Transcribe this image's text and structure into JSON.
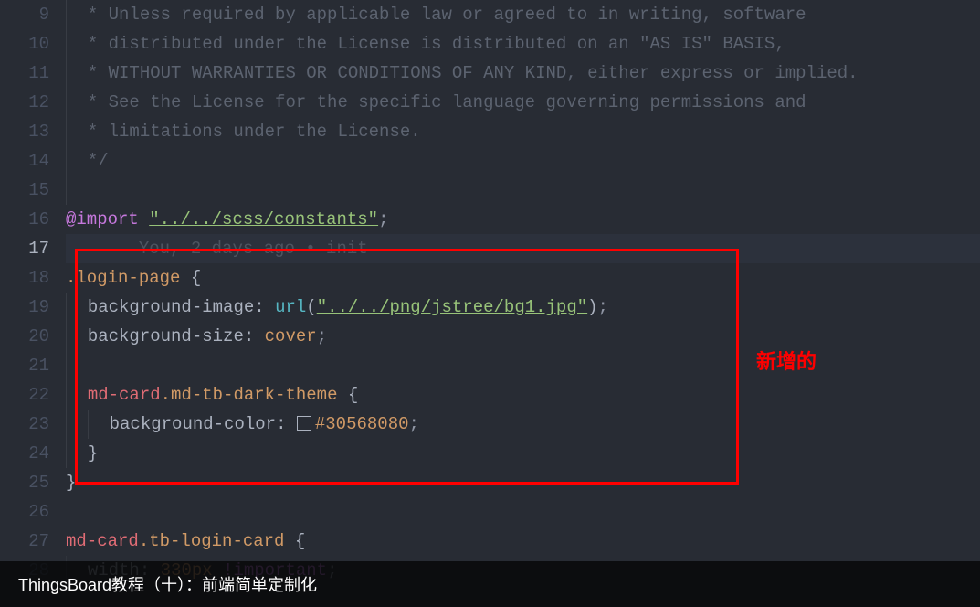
{
  "lines": {
    "start": 9,
    "end": 28
  },
  "comment": {
    "l9": " * Unless required by applicable law or agreed to in writing, software",
    "l10": " * distributed under the License is distributed on an \"AS IS\" BASIS,",
    "l11": " * WITHOUT WARRANTIES OR CONDITIONS OF ANY KIND, either express or implied.",
    "l12": " * See the License for the specific language governing permissions and",
    "l13": " * limitations under the License.",
    "l14": " */"
  },
  "code": {
    "import_kw": "@import",
    "import_path": "\"../../scss/constants\"",
    "semi": ";",
    "blame": "You, 2 days ago • init",
    "selector_login": ".login-page",
    "brace_open": " {",
    "brace_close": "}",
    "prop_bgimage": "background-image",
    "colon_sp": ": ",
    "func_url": "url",
    "paren_open": "(",
    "paren_close": ")",
    "url_path": "\"../../png/jstree/bg1.jpg\"",
    "prop_bgsize": "background-size",
    "val_cover": "cover",
    "tag_mdcard": "md-card",
    "class_darktheme": ".md-tb-dark-theme",
    "prop_bgcolor": "background-color",
    "hex_color": "#30568080",
    "class_logincard": ".tb-login-card",
    "prop_width": "width",
    "val_330px": "330px",
    "val_important": " !important"
  },
  "annotation": "新增的",
  "bottom_bar_text": "ThingsBoard教程（十）：前端简单定制化"
}
